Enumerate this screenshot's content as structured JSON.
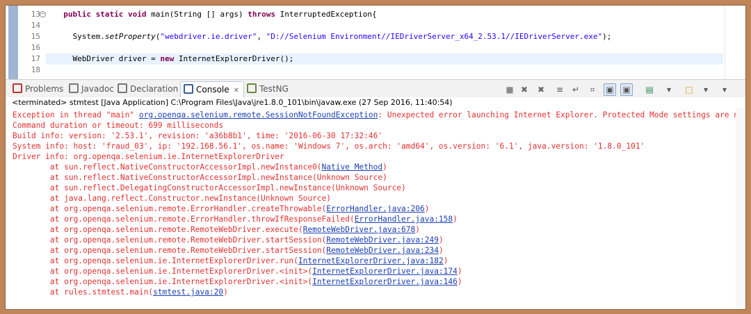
{
  "editor": {
    "lines": [
      {
        "num": "13",
        "code": [
          {
            "t": "  ",
            "c": ""
          },
          {
            "t": "public",
            "c": "kw"
          },
          {
            "t": " ",
            "c": ""
          },
          {
            "t": "static",
            "c": "kw"
          },
          {
            "t": " ",
            "c": ""
          },
          {
            "t": "void",
            "c": "kw"
          },
          {
            "t": " main(String [] args) ",
            "c": ""
          },
          {
            "t": "throws",
            "c": "kw"
          },
          {
            "t": " InterruptedException{",
            "c": ""
          }
        ],
        "fold": "⊖"
      },
      {
        "num": "14",
        "code": []
      },
      {
        "num": "15",
        "code": [
          {
            "t": "    System.",
            "c": ""
          },
          {
            "t": "setProperty",
            "c": "it"
          },
          {
            "t": "(",
            "c": ""
          },
          {
            "t": "\"webdriver.ie.driver\"",
            "c": "str"
          },
          {
            "t": ", ",
            "c": ""
          },
          {
            "t": "\"D://Selenium Environment//IEDriverServer_x64_2.53.1//IEDriverServer.exe\"",
            "c": "str"
          },
          {
            "t": ");",
            "c": ""
          }
        ]
      },
      {
        "num": "16",
        "code": []
      },
      {
        "num": "17",
        "code": [
          {
            "t": "    WebDriver ",
            "c": ""
          },
          {
            "t": "driver",
            "c": "var"
          },
          {
            "t": " = ",
            "c": ""
          },
          {
            "t": "new",
            "c": "kw"
          },
          {
            "t": " InternetExplorerDriver();",
            "c": ""
          }
        ],
        "current": true
      },
      {
        "num": "18",
        "code": []
      }
    ]
  },
  "tabs": [
    {
      "label": "Problems",
      "icon": "problems-icon",
      "color": "#c03030"
    },
    {
      "label": "Javadoc",
      "icon": "at-sign-icon",
      "color": "#777777"
    },
    {
      "label": "Declaration",
      "icon": "declaration-icon",
      "color": "#777777"
    },
    {
      "label": "Console",
      "icon": "console-icon",
      "color": "#3a5f8f",
      "active": true,
      "close": "✕"
    },
    {
      "label": "TestNG",
      "icon": "testng-icon",
      "color": "#6a8a3a"
    }
  ],
  "toolbar_icons": [
    "terminate-icon",
    "remove-launch-icon",
    "remove-all-icon",
    "scroll-lock-icon",
    "word-wrap-icon",
    "pin-console-icon",
    "show-on-output-icon",
    "show-on-error-icon",
    "display-selected-console-icon",
    "open-console-icon",
    "view-menu-icon"
  ],
  "status_line": "<terminated> stmtest [Java Application] C:\\Program Files\\Java\\jre1.8.0_101\\bin\\javaw.exe (27 Sep 2016, 11:40:54)",
  "console": {
    "error_color": "#e03131",
    "link_color": "#1b3fb4",
    "lines": [
      [
        {
          "t": "Exception in thread \"main\" "
        },
        {
          "t": "org.openqa.selenium.remote.SessionNotFoundException",
          "link": true
        },
        {
          "t": ": Unexpected error launching Internet Explorer. Protected Mode settings are not the same for all zones."
        }
      ],
      [
        {
          "t": "Command duration or timeout: 699 milliseconds"
        }
      ],
      [
        {
          "t": "Build info: version: '2.53.1', revision: 'a36b8b1', time: '2016-06-30 17:32:46'"
        }
      ],
      [
        {
          "t": "System info: host: 'fraud_03', ip: '192.168.56.1', os.name: 'Windows 7', os.arch: 'amd64', os.version: '6.1', java.version: '1.8.0_101'"
        }
      ],
      [
        {
          "t": "Driver info: org.openqa.selenium.ie.InternetExplorerDriver"
        }
      ],
      [
        {
          "t": "\tat sun.reflect.NativeConstructorAccessorImpl.newInstance0("
        },
        {
          "t": "Native Method",
          "link": true
        },
        {
          "t": ")"
        }
      ],
      [
        {
          "t": "\tat sun.reflect.NativeConstructorAccessorImpl.newInstance(Unknown Source)"
        }
      ],
      [
        {
          "t": "\tat sun.reflect.DelegatingConstructorAccessorImpl.newInstance(Unknown Source)"
        }
      ],
      [
        {
          "t": "\tat java.lang.reflect.Constructor.newInstance(Unknown Source)"
        }
      ],
      [
        {
          "t": "\tat org.openqa.selenium.remote.ErrorHandler.createThrowable("
        },
        {
          "t": "ErrorHandler.java:206",
          "link": true
        },
        {
          "t": ")"
        }
      ],
      [
        {
          "t": "\tat org.openqa.selenium.remote.ErrorHandler.throwIfResponseFailed("
        },
        {
          "t": "ErrorHandler.java:158",
          "link": true
        },
        {
          "t": ")"
        }
      ],
      [
        {
          "t": "\tat org.openqa.selenium.remote.RemoteWebDriver.execute("
        },
        {
          "t": "RemoteWebDriver.java:678",
          "link": true
        },
        {
          "t": ")"
        }
      ],
      [
        {
          "t": "\tat org.openqa.selenium.remote.RemoteWebDriver.startSession("
        },
        {
          "t": "RemoteWebDriver.java:249",
          "link": true
        },
        {
          "t": ")"
        }
      ],
      [
        {
          "t": "\tat org.openqa.selenium.remote.RemoteWebDriver.startSession("
        },
        {
          "t": "RemoteWebDriver.java:234",
          "link": true
        },
        {
          "t": ")"
        }
      ],
      [
        {
          "t": "\tat org.openqa.selenium.ie.InternetExplorerDriver.run("
        },
        {
          "t": "InternetExplorerDriver.java:182",
          "link": true
        },
        {
          "t": ")"
        }
      ],
      [
        {
          "t": "\tat org.openqa.selenium.ie.InternetExplorerDriver.<init>("
        },
        {
          "t": "InternetExplorerDriver.java:174",
          "link": true
        },
        {
          "t": ")"
        }
      ],
      [
        {
          "t": "\tat org.openqa.selenium.ie.InternetExplorerDriver.<init>("
        },
        {
          "t": "InternetExplorerDriver.java:146",
          "link": true
        },
        {
          "t": ")"
        }
      ],
      [
        {
          "t": "\tat rules.stmtest.main("
        },
        {
          "t": "stmtest.java:20",
          "link": true
        },
        {
          "t": ")"
        }
      ]
    ]
  }
}
